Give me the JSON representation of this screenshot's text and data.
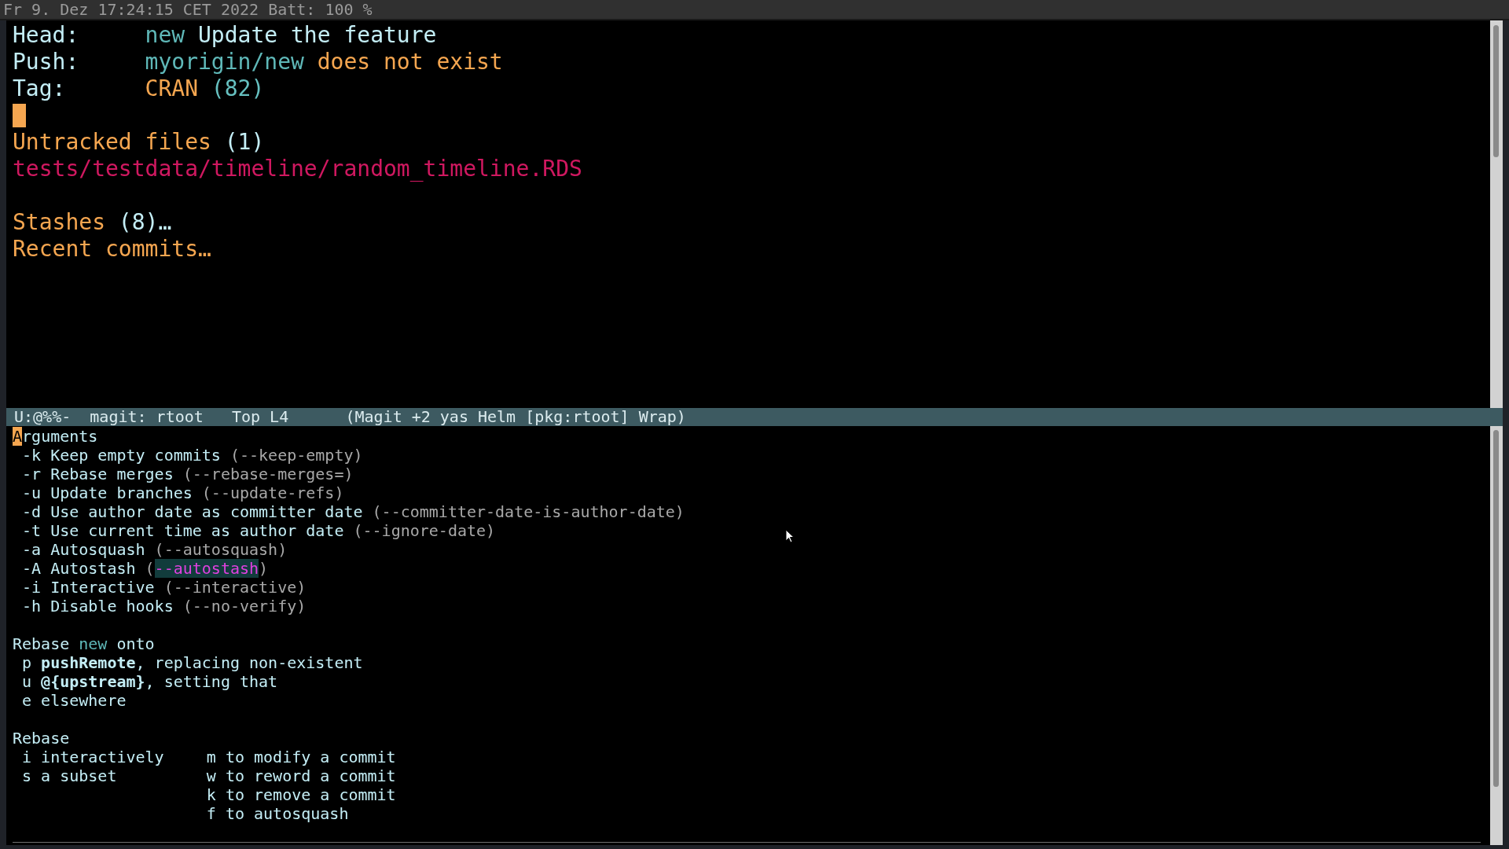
{
  "status_bar": {
    "text": "Fr 9. Dez 17:24:15 CET 2022 Batt: 100 %"
  },
  "status_pane": {
    "lines": [
      {
        "kind": "header",
        "label": "Head:",
        "parts": [
          {
            "kind": "branch",
            "text": "new"
          },
          {
            "kind": "plain",
            "text": "Update the feature"
          }
        ]
      },
      {
        "kind": "header",
        "label": "Push:",
        "parts": [
          {
            "kind": "branch",
            "text": "myorigin/new"
          },
          {
            "kind": "warning",
            "text": "does not exist"
          }
        ]
      },
      {
        "kind": "header",
        "label": "Tag:",
        "parts": [
          {
            "kind": "warning",
            "text": "CRAN"
          },
          {
            "kind": "count",
            "text": "(82)"
          }
        ]
      },
      {
        "kind": "cursor"
      },
      {
        "kind": "text",
        "parts": [
          {
            "kind": "heading",
            "text": "Untracked files"
          },
          {
            "kind": "plain",
            "text": "(1)"
          }
        ]
      },
      {
        "kind": "text",
        "parts": [
          {
            "kind": "file",
            "text": "tests/testdata/timeline/random_timeline.RDS"
          }
        ]
      },
      {
        "kind": "blank"
      },
      {
        "kind": "text",
        "parts": [
          {
            "kind": "heading",
            "text": "Stashes"
          },
          {
            "kind": "plain",
            "text": "(8)…"
          }
        ]
      },
      {
        "kind": "text",
        "parts": [
          {
            "kind": "heading",
            "text": "Recent commits…"
          }
        ]
      }
    ]
  },
  "mode_line": {
    "fields": [
      "U:@%%-",
      "magit: rtoot",
      "Top L4",
      "(Magit +2 yas Helm [pkg:rtoot] Wrap)"
    ]
  },
  "transient": {
    "sections": [
      {
        "title": [
          {
            "kind": "cursor",
            "text": "A"
          },
          {
            "kind": "plain",
            "text": "rguments"
          }
        ],
        "columns": [
          [
            {
              "key": "-k",
              "parts": [
                {
                  "kind": "plain",
                  "text": "Keep empty commits"
                },
                {
                  "kind": "dim",
                  "text": "(--keep-empty)"
                }
              ]
            },
            {
              "key": "-r",
              "parts": [
                {
                  "kind": "plain",
                  "text": "Rebase merges"
                },
                {
                  "kind": "dim",
                  "text": "(--rebase-merges=)"
                }
              ]
            },
            {
              "key": "-u",
              "parts": [
                {
                  "kind": "plain",
                  "text": "Update branches"
                },
                {
                  "kind": "dim",
                  "text": "(--update-refs)"
                }
              ]
            },
            {
              "key": "-d",
              "parts": [
                {
                  "kind": "plain",
                  "text": "Use author date as committer date"
                },
                {
                  "kind": "dim",
                  "text": "(--committer-date-is-author-date)"
                }
              ]
            },
            {
              "key": "-t",
              "parts": [
                {
                  "kind": "plain",
                  "text": "Use current time as author date"
                },
                {
                  "kind": "dim",
                  "text": "(--ignore-date)"
                }
              ]
            },
            {
              "key": "-a",
              "parts": [
                {
                  "kind": "plain",
                  "text": "Autosquash"
                },
                {
                  "kind": "dim",
                  "text": "(--autosquash)"
                }
              ]
            },
            {
              "key": "-A",
              "parts": [
                {
                  "kind": "plain",
                  "text": "Autostash"
                },
                {
                  "kind": "dim",
                  "text": "("
                },
                {
                  "kind": "active",
                  "text": "--autostash"
                },
                {
                  "kind": "dim",
                  "text": ")"
                }
              ]
            },
            {
              "key": "-i",
              "parts": [
                {
                  "kind": "plain",
                  "text": "Interactive"
                },
                {
                  "kind": "dim",
                  "text": "(--interactive)"
                }
              ]
            },
            {
              "key": "-h",
              "parts": [
                {
                  "kind": "plain",
                  "text": "Disable hooks"
                },
                {
                  "kind": "dim",
                  "text": "(--no-verify)"
                }
              ]
            }
          ]
        ]
      },
      {
        "title": [
          {
            "kind": "plain",
            "text": "Rebase"
          },
          {
            "kind": "branch",
            "text": "new"
          },
          {
            "kind": "plain",
            "text": "onto"
          }
        ],
        "columns": [
          [
            {
              "key": "p",
              "parts": [
                {
                  "kind": "plain",
                  "text": "**pushRemote**, replacing non-existent"
                }
              ]
            },
            {
              "key": "u",
              "parts": [
                {
                  "kind": "plain",
                  "text": "**@{upstream}**, setting that"
                }
              ]
            },
            {
              "key": "e",
              "parts": [
                {
                  "kind": "plain",
                  "text": "elsewhere"
                }
              ]
            }
          ]
        ]
      },
      {
        "title": [
          {
            "kind": "plain",
            "text": "Rebase"
          }
        ],
        "columns": [
          [
            {
              "key": "i",
              "parts": [
                {
                  "kind": "plain",
                  "text": "interactively"
                }
              ]
            },
            {
              "key": "s",
              "parts": [
                {
                  "kind": "plain",
                  "text": "a subset"
                }
              ]
            }
          ],
          [
            {
              "key": "m",
              "parts": [
                {
                  "kind": "plain",
                  "text": "to modify a commit"
                }
              ]
            },
            {
              "key": "w",
              "parts": [
                {
                  "kind": "plain",
                  "text": "to reword a commit"
                }
              ]
            },
            {
              "key": "k",
              "parts": [
                {
                  "kind": "plain",
                  "text": "to remove a commit"
                }
              ]
            },
            {
              "key": "f",
              "parts": [
                {
                  "kind": "plain",
                  "text": "to autosquash"
                }
              ]
            }
          ]
        ]
      }
    ]
  }
}
